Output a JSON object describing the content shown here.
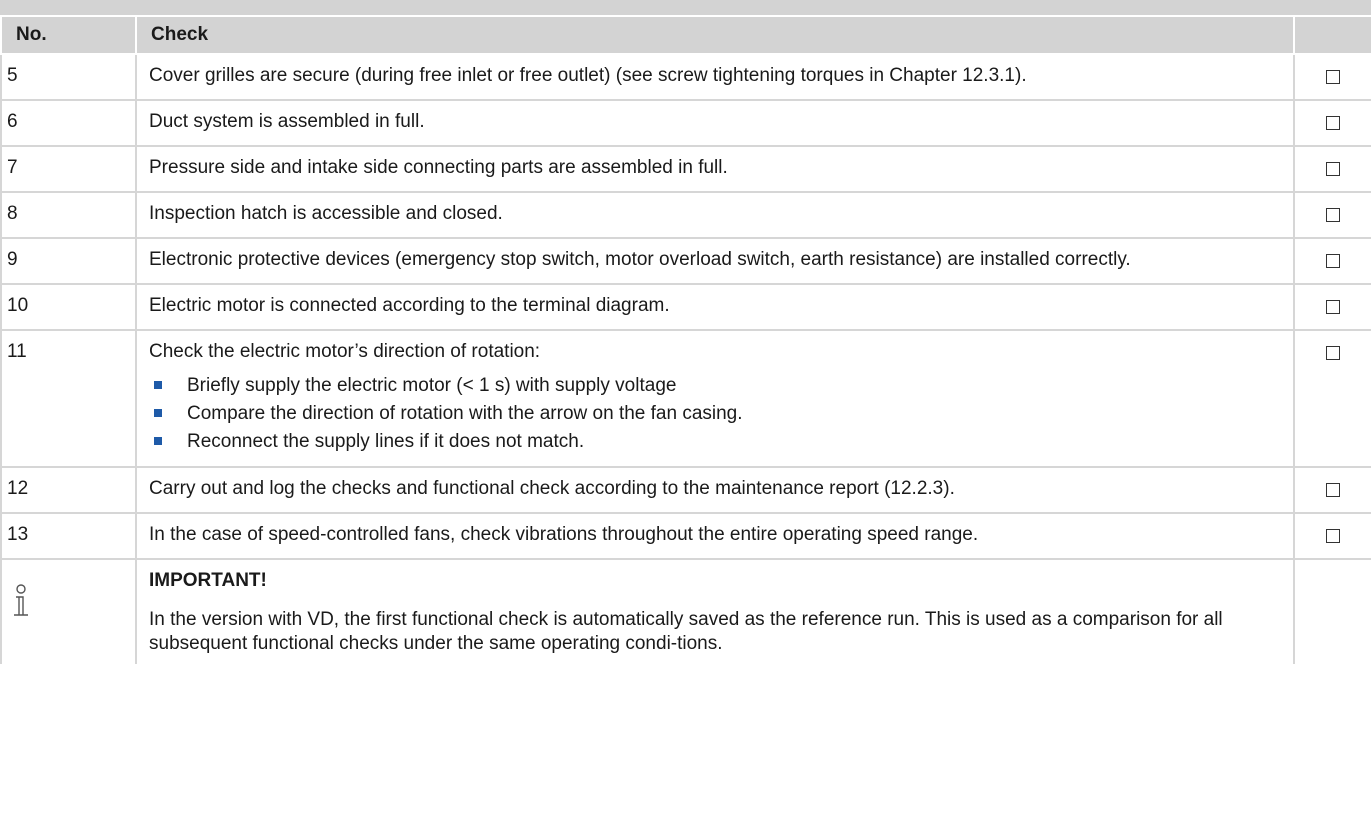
{
  "table": {
    "header": {
      "no": "No.",
      "check": "Check",
      "box": ""
    },
    "rows": [
      {
        "no": "5",
        "text": "Cover grilles are secure (during free inlet or free outlet) (see screw tightening torques in Chapter 12.3.1)."
      },
      {
        "no": "6",
        "text": "Duct system is assembled in full."
      },
      {
        "no": "7",
        "text": "Pressure side and intake side connecting parts are assembled in full."
      },
      {
        "no": "8",
        "text": "Inspection hatch is accessible and closed."
      },
      {
        "no": "9",
        "text": "Electronic protective devices (emergency stop switch, motor overload switch, earth resistance) are installed correctly."
      },
      {
        "no": "10",
        "text": "Electric motor is connected according to the terminal diagram."
      },
      {
        "no": "11",
        "text": "Check the electric motor’s direction of rotation:",
        "bullets": [
          "Briefly supply the electric motor (< 1 s) with supply voltage",
          "Compare the direction of rotation with the arrow on the fan casing.",
          "Reconnect the supply lines if it does not match."
        ]
      },
      {
        "no": "12",
        "text": "Carry out and log the checks and functional check according to the maintenance report (12.2.3)."
      },
      {
        "no": "13",
        "text": "In the case of speed-controlled fans, check vibrations throughout the entire operating speed range."
      }
    ]
  },
  "note": {
    "icon": "info-icon",
    "title": "IMPORTANT!",
    "body": "In the version with VD, the first functional check is automatically saved as the reference run. This is used as a comparison for all subsequent functional checks under the same operating condi-tions."
  },
  "colors": {
    "header_bg": "#d3d3d3",
    "bullet": "#1e5aa8",
    "grid": "#d6d6d6"
  }
}
